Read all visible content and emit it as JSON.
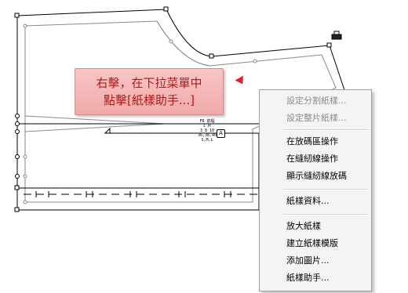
{
  "annotation": {
    "line1": "右擊，在下拉菜單中",
    "line2": "點擊[紙樣助手...]",
    "cursor_color": "#e02020"
  },
  "menu": {
    "items": [
      {
        "label": "設定分割紙樣...",
        "enabled": false
      },
      {
        "label": "設定整片紙樣...",
        "enabled": false
      },
      {
        "label": "在放碼區操作",
        "enabled": true
      },
      {
        "label": "在縫紉線操作",
        "enabled": true
      },
      {
        "label": "顯示縫紉線放碼",
        "enabled": true
      },
      {
        "label": "紙樣資料...",
        "enabled": true
      },
      {
        "label": "放大紙樣",
        "enabled": true
      },
      {
        "label": "建立紙樣模版",
        "enabled": true
      },
      {
        "label": "添加圖片...",
        "enabled": true
      },
      {
        "label": "紙樣助手...",
        "enabled": true
      }
    ]
  },
  "pattern": {
    "labels": [
      "FR 前幅",
      "1 片",
      "3 8 10",
      "36,38,40",
      "S,M,L"
    ],
    "anchor_label": "A"
  }
}
